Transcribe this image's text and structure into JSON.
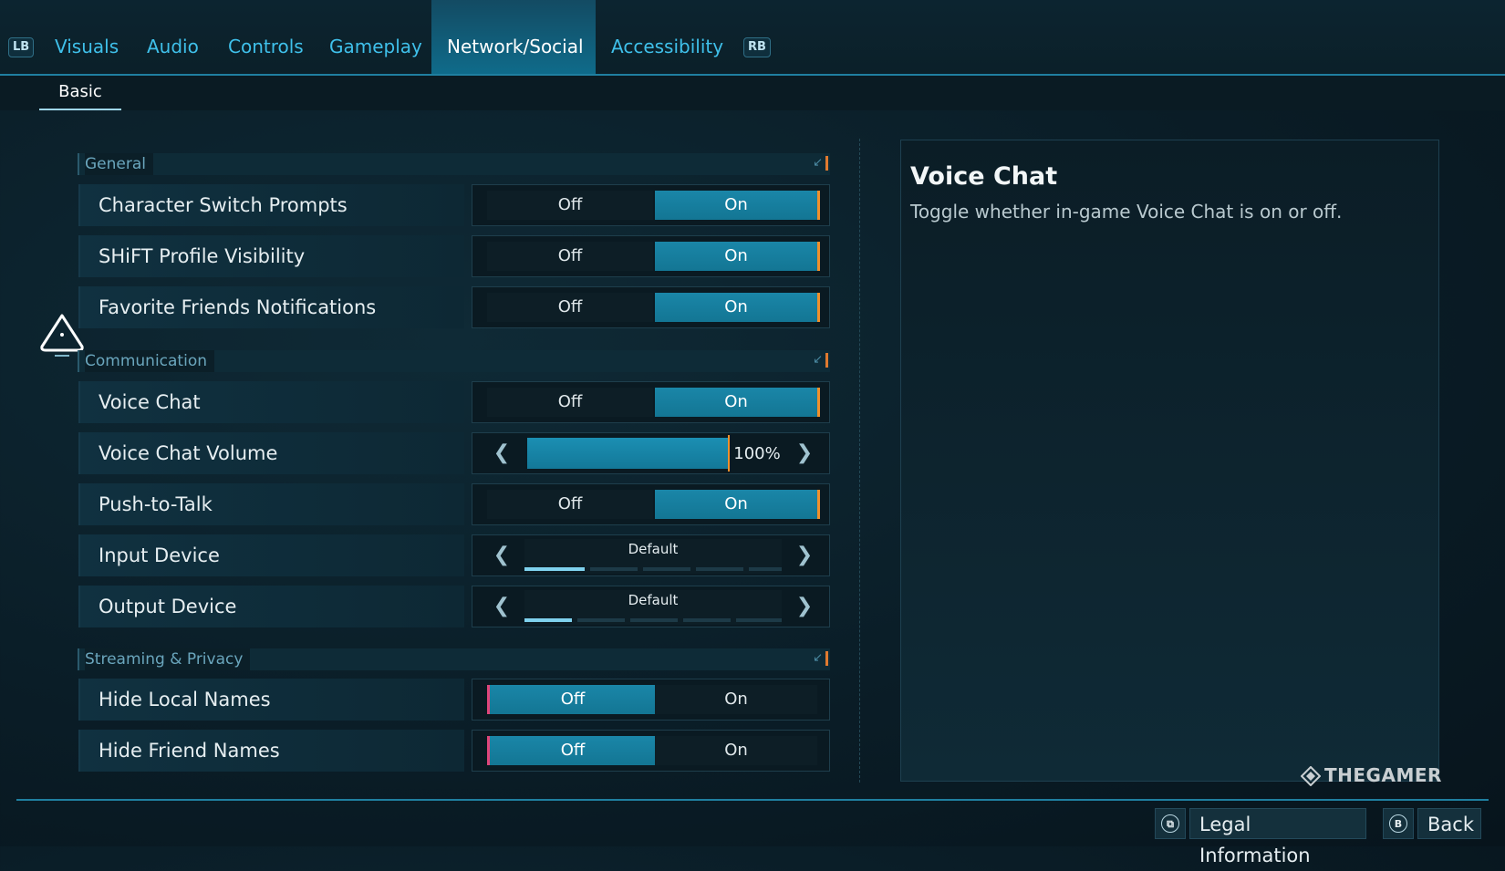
{
  "tabs": {
    "lb": "LB",
    "rb": "RB",
    "items": [
      "Visuals",
      "Audio",
      "Controls",
      "Gameplay",
      "Network/Social",
      "Accessibility"
    ],
    "active": "Network/Social"
  },
  "subtabs": {
    "basic": "Basic"
  },
  "sections": {
    "general": "General",
    "communication": "Communication",
    "streaming": "Streaming & Privacy"
  },
  "settings": {
    "character_switch": {
      "label": "Character Switch Prompts",
      "off": "Off",
      "on": "On",
      "value": "On"
    },
    "shift_profile": {
      "label": "SHiFT Profile Visibility",
      "off": "Off",
      "on": "On",
      "value": "On"
    },
    "favorite_friends": {
      "label": "Favorite Friends Notifications",
      "off": "Off",
      "on": "On",
      "value": "On"
    },
    "voice_chat": {
      "label": "Voice Chat",
      "off": "Off",
      "on": "On",
      "value": "On"
    },
    "voice_chat_volume": {
      "label": "Voice Chat Volume",
      "value": "100%",
      "fraction": 1.0
    },
    "push_to_talk": {
      "label": "Push-to-Talk",
      "off": "Off",
      "on": "On",
      "value": "On"
    },
    "input_device": {
      "label": "Input Device",
      "value": "Default",
      "option_index": 0,
      "option_count": 5
    },
    "output_device": {
      "label": "Output Device",
      "value": "Default",
      "option_index": 0,
      "option_count": 5
    },
    "hide_local_names": {
      "label": "Hide Local Names",
      "off": "Off",
      "on": "On",
      "value": "Off"
    },
    "hide_friend_names": {
      "label": "Hide Friend Names",
      "off": "Off",
      "on": "On",
      "value": "Off"
    }
  },
  "info": {
    "title": "Voice Chat",
    "description": "Toggle whether in-game Voice Chat is on or off."
  },
  "watermark": "THEGAMER",
  "footer": {
    "legal": "Legal Information",
    "back_icon": "B",
    "back": "Back"
  },
  "colors": {
    "accent": "#1a86a8",
    "on_marker": "#f0902c",
    "off_marker": "#e0457a",
    "tab_text": "#3fc0ea"
  }
}
